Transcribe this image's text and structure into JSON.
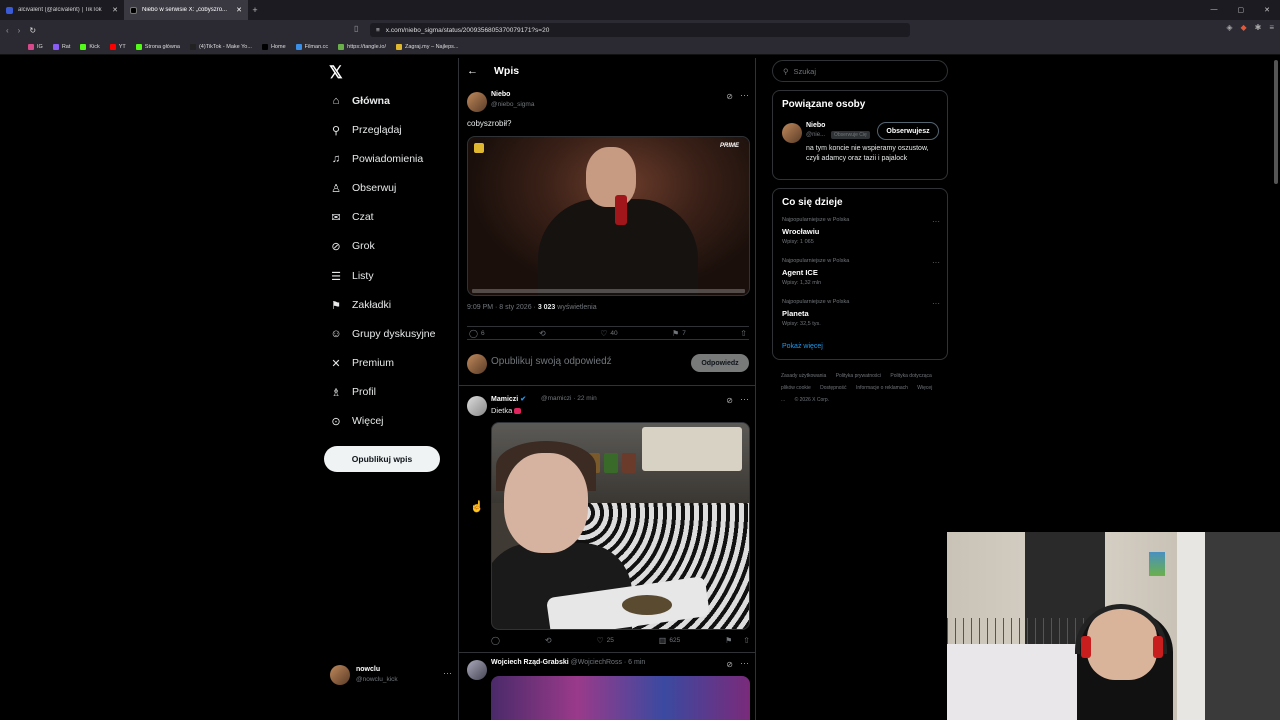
{
  "browser": {
    "tabs": [
      {
        "label": "alcivalent (@alcivalent) | TikTok"
      },
      {
        "label": "Niebo w serwisie X: „cobyszro..."
      }
    ],
    "url": "x.com/niebo_sigma/status/2009356805370079171?s=20",
    "bookmarks": [
      "IG",
      "Rat",
      "Kick",
      "YT",
      "Strona główna",
      "(4)TikTok - Make Yo...",
      "Home",
      "Filman.cc",
      "https://tangle.io/",
      "Zagraj.my – Najleps..."
    ]
  },
  "nav": {
    "items": [
      {
        "label": "Główna",
        "icon": "home-icon"
      },
      {
        "label": "Przeglądaj",
        "icon": "search-icon"
      },
      {
        "label": "Powiadomienia",
        "icon": "bell-icon"
      },
      {
        "label": "Obserwuj",
        "icon": "person-add-icon"
      },
      {
        "label": "Czat",
        "icon": "mail-icon"
      },
      {
        "label": "Grok",
        "icon": "grok-icon"
      },
      {
        "label": "Listy",
        "icon": "list-icon"
      },
      {
        "label": "Zakładki",
        "icon": "bookmark-icon"
      },
      {
        "label": "Grupy dyskusyjne",
        "icon": "people-icon"
      },
      {
        "label": "Premium",
        "icon": "x-icon"
      },
      {
        "label": "Profil",
        "icon": "person-icon"
      },
      {
        "label": "Więcej",
        "icon": "more-icon"
      }
    ],
    "post_button": "Opublikuj wpis",
    "account": {
      "name": "nowclu",
      "handle": "@nowclu_kick"
    }
  },
  "main": {
    "header": "Wpis",
    "post": {
      "name": "Niebo",
      "handle": "@niebo_sigma",
      "text": "cobyszrobił?",
      "video_logo": "PRIME",
      "time": "9:09 PM · 8 sty 2026 · ",
      "views": "3 023",
      "views_label": " wyświetlenia",
      "replies": "6",
      "likes": "40",
      "bookmarks": "7"
    },
    "reply_box": {
      "placeholder": "Opublikuj swoją odpowiedź",
      "button": "Odpowiedz"
    },
    "comment1": {
      "name": "Mamiczi",
      "handle": "@mamiczi · 22 min",
      "text": "Dietka",
      "likes": "25",
      "views": "625"
    },
    "comment2": {
      "name": "Wojciech Rząd-Grabski",
      "handle": "@WojciechRoss · 6 min"
    }
  },
  "right": {
    "search_placeholder": "Szukaj",
    "related_title": "Powiązane osoby",
    "related": {
      "name": "Niebo",
      "handle": "@nie...",
      "follows_you": "Obserwuje Cię",
      "button": "Obserwujesz",
      "bio": "na tym koncie nie wspieramy oszustow, czyli adamcy oraz tazii i pajalock"
    },
    "trends_title": "Co się dzieje",
    "trends": [
      {
        "context": "Najpopularniejsze w Polska",
        "title": "Wrocławiu",
        "count": "Wpisy: 1 065"
      },
      {
        "context": "Najpopularniejsze w Polska",
        "title": "Agent ICE",
        "count": "Wpisy: 1,32 mln"
      },
      {
        "context": "Najpopularniejsze w Polska",
        "title": "Planeta",
        "count": "Wpisy: 32,5 tys."
      }
    ],
    "show_more": "Pokaż więcej",
    "footer": [
      "Zasady użytkowania",
      "Polityka prywatności",
      "Polityka dotycząca plików cookie",
      "Dostępność",
      "Informacje o reklamach",
      "Więcej ...",
      "© 2026 X Corp."
    ]
  }
}
